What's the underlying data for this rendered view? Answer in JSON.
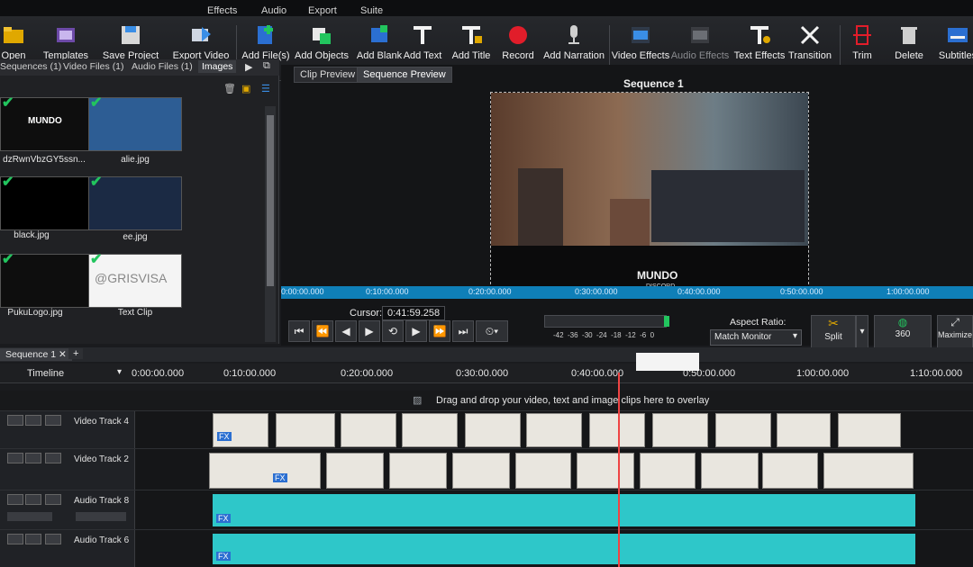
{
  "menu": {
    "items": [
      "Effects",
      "Audio",
      "Export",
      "Suite"
    ]
  },
  "toolbar": {
    "items": [
      {
        "label": "Open"
      },
      {
        "label": "Templates"
      },
      {
        "label": "Save Project"
      },
      {
        "label": "Export Video"
      },
      {
        "label": "Add File(s)"
      },
      {
        "label": "Add Objects"
      },
      {
        "label": "Add Blank"
      },
      {
        "label": "Add Text"
      },
      {
        "label": "Add Title"
      },
      {
        "label": "Record"
      },
      {
        "label": "Add Narration"
      },
      {
        "label": "Video Effects"
      },
      {
        "label": "Audio Effects"
      },
      {
        "label": "Text Effects"
      },
      {
        "label": "Transition"
      },
      {
        "label": "Trim"
      },
      {
        "label": "Delete"
      },
      {
        "label": "Subtitles"
      }
    ]
  },
  "bin": {
    "tabs": [
      "Sequences",
      "Video Files",
      "Audio Files",
      "Images"
    ],
    "tab_counts": [
      "(1)",
      "(1)",
      "(1)",
      ""
    ],
    "files": [
      {
        "name": "dzRwnVbzGY5ssn...",
        "thumb_text": "MUNDO"
      },
      {
        "name": "alie.jpg",
        "thumb_text": ""
      },
      {
        "name": "black.jpg",
        "thumb_text": ""
      },
      {
        "name": "ee.jpg",
        "thumb_text": ""
      },
      {
        "name": "PukuLogo.jpg",
        "thumb_text": ""
      },
      {
        "name": "Text Clip",
        "thumb_text": "@GRISVISA"
      }
    ]
  },
  "preview": {
    "tabs": [
      "Clip Preview",
      "Sequence Preview"
    ],
    "sequence_title": "Sequence 1",
    "monitor_caption": "MUNDO",
    "monitor_sub": "DISCORD",
    "scrubber_ticks": [
      "0:00:00.000",
      "0:10:00.000",
      "0:20:00.000",
      "0:30:00.000",
      "0:40:00.000",
      "0:50:00.000",
      "1:00:00.000"
    ]
  },
  "transport": {
    "cursor_label": "Cursor:",
    "cursor_value": "0:41:59.258",
    "meter_ticks": [
      "-42",
      "-36",
      "-30",
      "-24",
      "-18",
      "-12",
      "-6",
      "0"
    ],
    "aspect_label": "Aspect Ratio:",
    "aspect_value": "Match Monitor",
    "split_label": "Split",
    "btn_360": "360",
    "maximize_label": "Maximize"
  },
  "timeline": {
    "sequence_tab": "Sequence 1",
    "ruler_label": "Timeline",
    "ticks": [
      "0:00:00.000",
      "0:10:00.000",
      "0:20:00.000",
      "0:30:00.000",
      "0:40:00.000",
      "0:50:00.000",
      "1:00:00.000",
      "1:10:00.000"
    ],
    "drop_hint": "Drag and drop your video, text and image clips here to overlay",
    "tracks": [
      {
        "name": "Video Track 4",
        "kind": "video"
      },
      {
        "name": "Video Track 2",
        "kind": "video"
      },
      {
        "name": "Audio Track 8",
        "kind": "audio"
      },
      {
        "name": "Audio Track 6",
        "kind": "audio"
      }
    ],
    "clip_badges": [
      "FX"
    ]
  },
  "colors": {
    "accent": "#0f7fb8",
    "playhead": "#ef4444",
    "audio_wave": "#2ec7c9",
    "check": "#22c55e",
    "record": "#e11d2a"
  }
}
